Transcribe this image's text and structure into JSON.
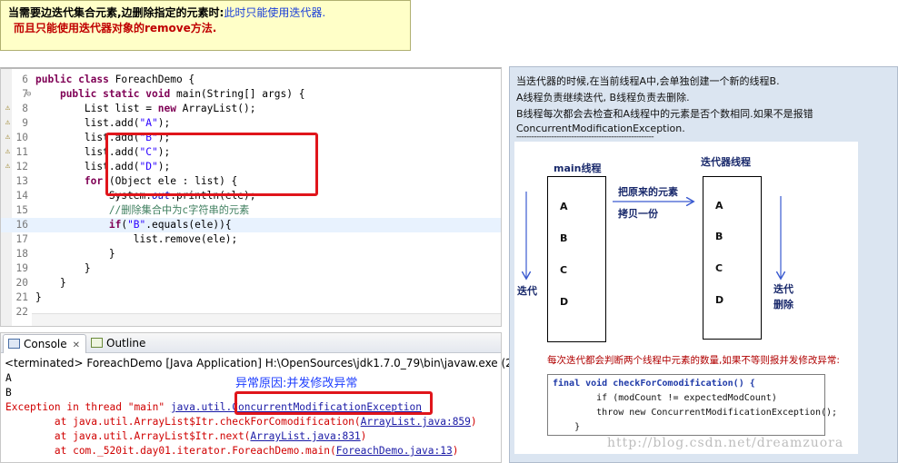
{
  "note": {
    "line1_bold": "当需要边迭代集合元素,边删除指定的元素时:",
    "line1_blue": "此时只能使用迭代器.",
    "line2": "而且只能使用迭代器对象的remove方法."
  },
  "editor": {
    "lines": [
      {
        "num": "6",
        "code": "public class ForeachDemo {"
      },
      {
        "num": "7",
        "code": "    public static void main(String[] args) {"
      },
      {
        "num": "8",
        "code": "        List list = new ArrayList();"
      },
      {
        "num": "9",
        "code": "        list.add(\"A\");"
      },
      {
        "num": "10",
        "code": "        list.add(\"B\");"
      },
      {
        "num": "11",
        "code": "        list.add(\"C\");"
      },
      {
        "num": "12",
        "code": "        list.add(\"D\");"
      },
      {
        "num": "13",
        "code": "        for (Object ele : list) {"
      },
      {
        "num": "14",
        "code": "            System.out.println(ele);"
      },
      {
        "num": "15",
        "code": "            //删除集合中为c字符串的元素"
      },
      {
        "num": "16",
        "code": "            if(\"B\".equals(ele)){"
      },
      {
        "num": "17",
        "code": "                list.remove(ele);"
      },
      {
        "num": "18",
        "code": "            }"
      },
      {
        "num": "19",
        "code": "        }"
      },
      {
        "num": "20",
        "code": "    }"
      },
      {
        "num": "21",
        "code": "}"
      },
      {
        "num": "22",
        "code": ""
      }
    ]
  },
  "console": {
    "tab_console": "Console",
    "tab_outline": "Outline",
    "terminated": "<terminated> ForeachDemo [Java Application] H:\\OpenSources\\jdk1.7.0_79\\bin\\javaw.exe (2016-4-25 下午4:20",
    "out_a": "A",
    "out_b": "B",
    "cause_label": "异常原因:并发修改异常",
    "exc_prefix": "Exception in thread \"main\" ",
    "exc_pkg": "java.util.",
    "exc_class": "ConcurrentModificationException",
    "trace": [
      {
        "prefix": "        at java.util.ArrayList$Itr.checkForComodification(",
        "link": "ArrayList.java:859",
        "suffix": ")"
      },
      {
        "prefix": "        at java.util.ArrayList$Itr.next(",
        "link": "ArrayList.java:831",
        "suffix": ")"
      },
      {
        "prefix": "        at com._520it.day01.iterator.ForeachDemo.main(",
        "link": "ForeachDemo.java:13",
        "suffix": ")"
      }
    ]
  },
  "right": {
    "t1": "当迭代器的时候,在当前线程A中,会单独创建一个新的线程B.",
    "t2": "A线程负责继续迭代, B线程负责去删除.",
    "t3": "B线程每次都会去检查和A线程中的元素是否个数相同.如果不是报错",
    "t4": "ConcurrentModificationException.",
    "t5": "-------------------------------------------------------",
    "diagram": {
      "main_thread": "main线程",
      "iter_thread": "迭代器线程",
      "copy_1": "把原来的元素",
      "copy_2": "拷贝一份",
      "iterate": "迭代",
      "iterate2": "迭代",
      "delete": "删除",
      "letters_left": [
        "A",
        "B",
        "C",
        "D"
      ],
      "letters_right": [
        "A",
        "B",
        "C",
        "D"
      ],
      "note": "每次迭代都会判断两个线程中元素的数量,如果不等则报并发修改异常:",
      "snippet": [
        "final void checkForComodification() {",
        "        if (modCount != expectedModCount)",
        "        throw new ConcurrentModificationException();",
        "    }"
      ]
    }
  },
  "watermark": "http://blog.csdn.net/dreamzuora",
  "colors": {
    "accent_red": "#e0151b",
    "keyword": "#7f0055",
    "string": "#2a00ff",
    "comment": "#3f7f5f",
    "link_blue": "#1a1aa6"
  }
}
